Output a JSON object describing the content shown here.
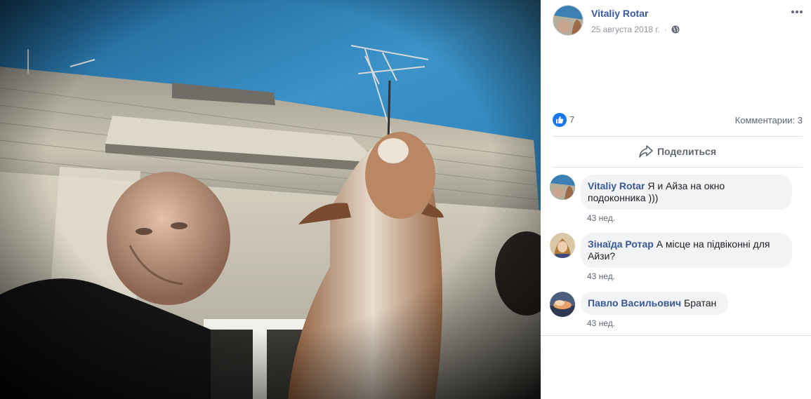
{
  "photo": {
    "alt": "Selfie of a man and a dog below a building with an antenna"
  },
  "post": {
    "author": "Vitaliy Rotar",
    "date": "25 августа 2018 г.",
    "separator": "·",
    "privacy_icon": "globe-icon",
    "more_icon": "more-options-icon"
  },
  "reactions": {
    "icon": "like-icon",
    "count": "7",
    "comments_label": "Комментарии: 3"
  },
  "actions": {
    "share_label": "Поделиться",
    "share_icon": "share-arrow-icon"
  },
  "comments": [
    {
      "author": "Vitaliy Rotar",
      "text": "Я и Айза на окно",
      "text_line2": "подоконника )))",
      "time": "43 нед."
    },
    {
      "author": "Зінаїда Ротар",
      "text": "А місце на підвіконні для",
      "text_line2": "Айзи?",
      "time": "43 нед."
    },
    {
      "author": "Павло Васильович",
      "text": "Братан",
      "time": "43 нед."
    }
  ],
  "colors": {
    "link_blue": "#385898",
    "like_blue": "#1877f2",
    "bubble_gray": "#f2f3f5",
    "meta_gray": "#90949c"
  }
}
